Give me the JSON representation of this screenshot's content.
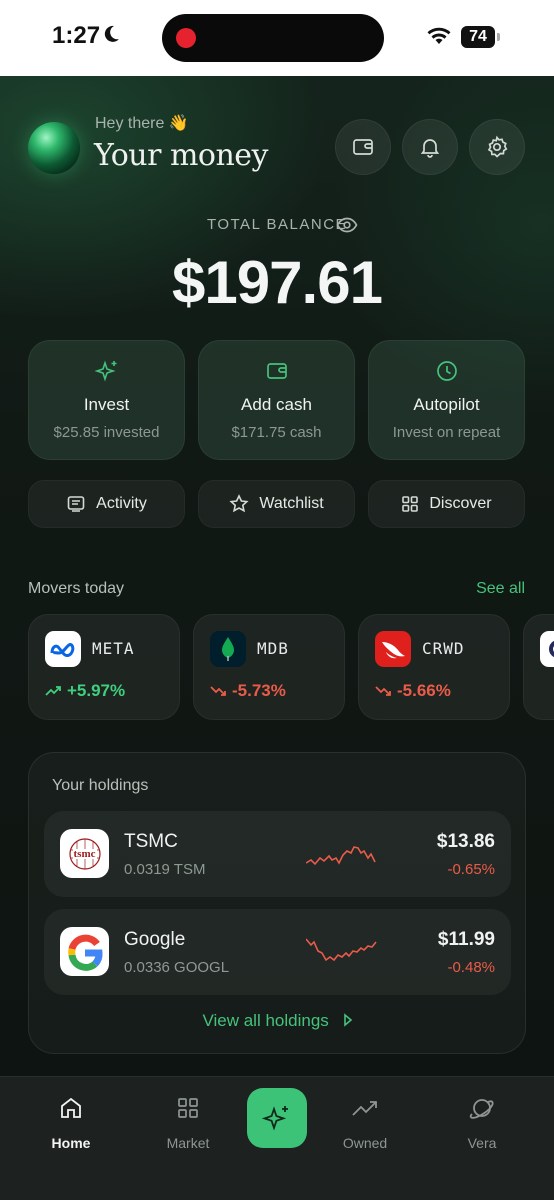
{
  "status_bar": {
    "time": "1:27",
    "battery": "74"
  },
  "header": {
    "greeting": "Hey there 👋",
    "title": "Your money"
  },
  "balance": {
    "label": "TOTAL BALANCE",
    "amount": "$197.61"
  },
  "actions": [
    {
      "label": "Invest",
      "sub": "$25.85 invested",
      "icon": "sparkle-icon"
    },
    {
      "label": "Add cash",
      "sub": "$171.75 cash",
      "icon": "wallet-icon"
    },
    {
      "label": "Autopilot",
      "sub": "Invest on repeat",
      "icon": "clock-icon"
    }
  ],
  "pills": [
    {
      "label": "Activity",
      "icon": "receipt-icon"
    },
    {
      "label": "Watchlist",
      "icon": "star-icon"
    },
    {
      "label": "Discover",
      "icon": "grid-icon"
    }
  ],
  "movers": {
    "title": "Movers today",
    "see_all": "See all",
    "items": [
      {
        "ticker": "META",
        "change": "+5.97%",
        "direction": "up",
        "logo_color": "#ffffff"
      },
      {
        "ticker": "MDB",
        "change": "-5.73%",
        "direction": "down",
        "logo_color": "#001e2b"
      },
      {
        "ticker": "CRWD",
        "change": "-5.66%",
        "direction": "down",
        "logo_color": "#e0201c"
      }
    ]
  },
  "holdings": {
    "title": "Your holdings",
    "items": [
      {
        "name": "TSMC",
        "qty": "0.0319 TSM",
        "price": "$13.86",
        "change": "-0.65%",
        "logo_text": "tsmc"
      },
      {
        "name": "Google",
        "qty": "0.0336 GOOGL",
        "price": "$11.99",
        "change": "-0.48%",
        "logo_text": "G"
      }
    ],
    "view_all": "View all holdings"
  },
  "nav": [
    {
      "label": "Home",
      "icon": "home-icon",
      "active": true
    },
    {
      "label": "Market",
      "icon": "grid-icon"
    },
    {
      "label": "",
      "icon": "sparkle-icon"
    },
    {
      "label": "Owned",
      "icon": "trend-icon"
    },
    {
      "label": "Vera",
      "icon": "planet-icon"
    }
  ],
  "colors": {
    "accent": "#3cc377",
    "up": "#3fcf7d",
    "down": "#ea5b4a"
  }
}
